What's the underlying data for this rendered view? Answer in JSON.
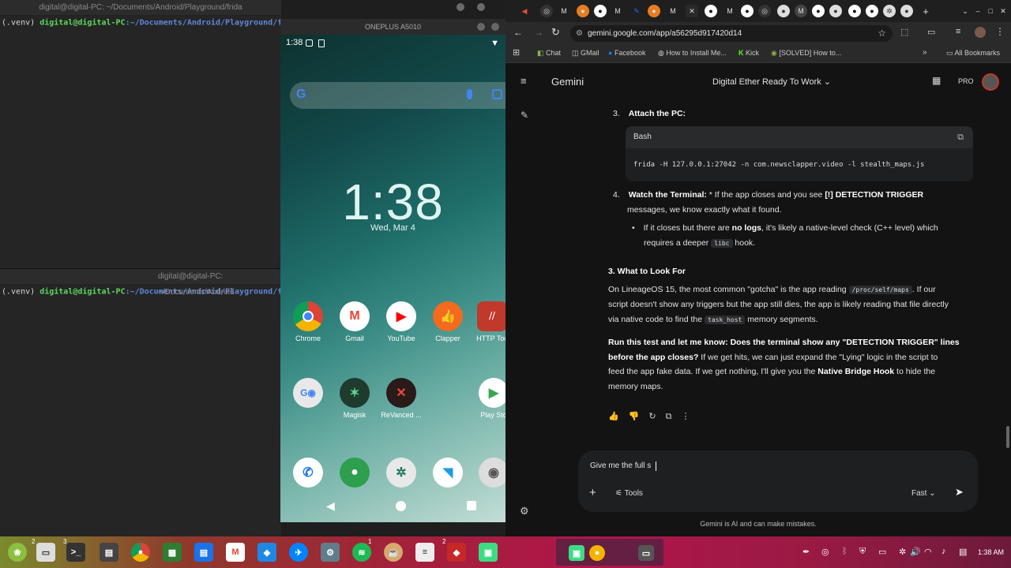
{
  "terminal_top": {
    "title": "digital@digital-PC: ~/Documents/Android/Playground/frida",
    "venv": "(.venv)",
    "user": "digital@digital-PC",
    "path": ":~/Documents/Android/Playground/frida$"
  },
  "terminal_bottom": {
    "title": "digital@digital-PC: ~/Documents/Android",
    "venv": "(.venv)",
    "user": "digital@digital-PC",
    "path": ":~/Documents/Android/Playground/frida$"
  },
  "phone": {
    "window_title": "ONEPLUS A5010",
    "status_time": "1:38",
    "clock": "1:38",
    "date": "Wed, Mar 4",
    "apps_row1": [
      "Chrome",
      "Gmail",
      "YouTube",
      "Clapper",
      "HTTP Toc"
    ],
    "apps_row2": [
      "",
      "Magisk",
      "ReVanced ...",
      "Play Sto"
    ]
  },
  "browser": {
    "url": "gemini.google.com/app/a56295d917420d14",
    "bookmarks": [
      "Chat",
      "GMail",
      "Facebook",
      "How to Install Me...",
      "Kick",
      "[SOLVED] How to...",
      "All Bookmarks"
    ],
    "app_name": "Gemini",
    "conversation_title": "Digital Ether Ready To Work",
    "badge": "PRO"
  },
  "chat": {
    "step3_num": "3.",
    "step3_title": "Attach the PC:",
    "code_lang": "Bash",
    "code": "frida -H 127.0.0.1:27042 -n com.newsclapper.video -l stealth_maps.js",
    "step4_num": "4.",
    "step4_title": "Watch the Terminal:",
    "step4_a": " * If the app closes and you see ",
    "step4_b": "[!] DETECTION TRIGGER",
    "step4_c": "messages, we know exactly what it found.",
    "bullet_a": "If it closes but there are ",
    "bullet_b": "no logs",
    "bullet_c": ", it's likely a native-level check (C++ level) which",
    "bullet_d": "requires a deeper ",
    "bullet_code": "libc",
    "bullet_e": " hook.",
    "section_title": "3. What to Look For",
    "p1_a": "On LineageOS 15, the most common \"gotcha\" is the app reading ",
    "p1_code": "/proc/self/maps",
    "p1_b": ". If our",
    "p1_c": "script doesn't show any triggers but the app still dies, the app is likely reading that file directly",
    "p1_d": "via native code to find the ",
    "p1_code2": "task_host",
    "p1_e": " memory segments.",
    "p2_bold1": "Run this test and let me know: Does the terminal show any \"DETECTION TRIGGER\" lines",
    "p2_bold2": "before the app closes?",
    "p2_a": " If we get hits, we can just expand the \"Lying\" logic in the script to",
    "p2_b": "feed the app fake data. If we get nothing, I'll give you the ",
    "p2_bold3": "Native Bridge Hook",
    "p2_c": " to hide the",
    "p2_d": "memory maps."
  },
  "composer": {
    "typed": "Give me the full s",
    "tools_label": "Tools",
    "mode": "Fast"
  },
  "disclaimer": "Gemini is AI and can make mistakes.",
  "taskbar": {
    "time": "1:38 AM",
    "badge_a": "2",
    "badge_b": "3",
    "badge_c": "1",
    "badge_d": "2"
  }
}
